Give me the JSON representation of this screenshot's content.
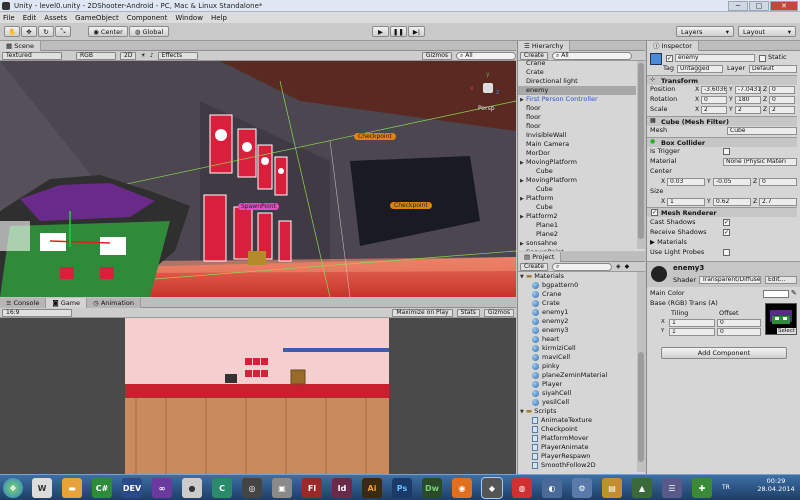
{
  "window": {
    "title": "Unity - level0.unity - 2DShooter-Android - PC, Mac & Linux Standalone*",
    "controls": [
      "─",
      "□",
      "✕"
    ]
  },
  "menu": [
    "File",
    "Edit",
    "Assets",
    "GameObject",
    "Component",
    "Window",
    "Help"
  ],
  "toolbar": {
    "center": "Center",
    "global": "Global",
    "layers": "Layers",
    "layout": "Layout"
  },
  "scene": {
    "tab": "Scene",
    "render_mode": "Textured",
    "color_mode": "RGB",
    "mode_2d": "2D",
    "effects": "Effects",
    "gizmos": "Gizmos",
    "search": "All",
    "labels": [
      "Checkpoint",
      "SpawnPoint",
      "Checkpoint"
    ],
    "persp": "Persp",
    "gizmo_axes": [
      "y",
      "x",
      "z"
    ]
  },
  "bottom_tabs": [
    "Console",
    "Game",
    "Animation"
  ],
  "game": {
    "aspect": "16:9",
    "maximize": "Maximize on Play",
    "stats": "Stats",
    "gizmos": "Gizmos"
  },
  "hierarchy": {
    "tab": "Hierarchy",
    "create": "Create",
    "search": "All",
    "items": [
      {
        "label": "Crane",
        "indent": 0,
        "arrow": false,
        "selected": false,
        "blue": false
      },
      {
        "label": "Crate",
        "indent": 0,
        "arrow": false,
        "selected": false,
        "blue": false
      },
      {
        "label": "Directional light",
        "indent": 0,
        "arrow": false,
        "selected": false,
        "blue": false
      },
      {
        "label": "enemy",
        "indent": 0,
        "arrow": false,
        "selected": true,
        "blue": false
      },
      {
        "label": "First Person Controller",
        "indent": 0,
        "arrow": true,
        "selected": false,
        "blue": true
      },
      {
        "label": "floor",
        "indent": 0,
        "arrow": false,
        "selected": false,
        "blue": false
      },
      {
        "label": "floor",
        "indent": 0,
        "arrow": false,
        "selected": false,
        "blue": false
      },
      {
        "label": "floor",
        "indent": 0,
        "arrow": false,
        "selected": false,
        "blue": false
      },
      {
        "label": "InvisibleWall",
        "indent": 0,
        "arrow": false,
        "selected": false,
        "blue": false
      },
      {
        "label": "Main Camera",
        "indent": 0,
        "arrow": false,
        "selected": false,
        "blue": false
      },
      {
        "label": "MorDor",
        "indent": 0,
        "arrow": false,
        "selected": false,
        "blue": false
      },
      {
        "label": "MovingPlatform",
        "indent": 0,
        "arrow": true,
        "selected": false,
        "blue": false
      },
      {
        "label": "Cube",
        "indent": 1,
        "arrow": false,
        "selected": false,
        "blue": false
      },
      {
        "label": "MovingPlatform",
        "indent": 0,
        "arrow": true,
        "selected": false,
        "blue": false
      },
      {
        "label": "Cube",
        "indent": 1,
        "arrow": false,
        "selected": false,
        "blue": false
      },
      {
        "label": "Platform",
        "indent": 0,
        "arrow": true,
        "selected": false,
        "blue": false
      },
      {
        "label": "Cube",
        "indent": 1,
        "arrow": false,
        "selected": false,
        "blue": false
      },
      {
        "label": "Platform2",
        "indent": 0,
        "arrow": true,
        "selected": false,
        "blue": false
      },
      {
        "label": "Plane1",
        "indent": 1,
        "arrow": false,
        "selected": false,
        "blue": false
      },
      {
        "label": "Plane2",
        "indent": 1,
        "arrow": false,
        "selected": false,
        "blue": false
      },
      {
        "label": "sonsahne",
        "indent": 0,
        "arrow": true,
        "selected": false,
        "blue": false
      },
      {
        "label": "SpawnPoint",
        "indent": 0,
        "arrow": false,
        "selected": false,
        "blue": false
      }
    ]
  },
  "project": {
    "tab": "Project",
    "create": "Create",
    "materials_folder": "Materials",
    "materials": [
      "bgpattern0",
      "Crane",
      "Crate",
      "enemy1",
      "enemy2",
      "enemy3",
      "heart",
      "kirmiziCell",
      "maviCell",
      "pinky",
      "planeZeminMaterial",
      "Player",
      "siyahCell",
      "yesilCell"
    ],
    "scripts_folder": "Scripts",
    "scripts": [
      "AnimateTexture",
      "Checkpoint",
      "PlatformMover",
      "PlayerAnimate",
      "PlayerRespawn",
      "SmoothFollow2D"
    ]
  },
  "inspector": {
    "tab": "Inspector",
    "object_name": "enemy",
    "static": "Static",
    "tag_label": "Tag",
    "tag": "Untagged",
    "layer_label": "Layer",
    "layer": "Default",
    "transform": {
      "title": "Transform",
      "position_label": "Position",
      "position": [
        "-3.6036",
        "-7.0431",
        "0"
      ],
      "rotation_label": "Rotation",
      "rotation": [
        "0",
        "180",
        "0"
      ],
      "scale_label": "Scale",
      "scale": [
        "2",
        "2",
        "2"
      ]
    },
    "mesh_filter": {
      "title": "Cube (Mesh Filter)",
      "mesh_label": "Mesh",
      "mesh": "Cube"
    },
    "box_collider": {
      "title": "Box Collider",
      "is_trigger": "Is Trigger",
      "material_label": "Material",
      "material": "None (Physic Materi",
      "center_label": "Center",
      "center": [
        "0.03",
        "-0.05",
        "0"
      ],
      "size_label": "Size",
      "size": [
        "1",
        "0.62",
        "2.7"
      ]
    },
    "mesh_renderer": {
      "title": "Mesh Renderer",
      "cast_shadows": "Cast Shadows",
      "receive_shadows": "Receive Shadows",
      "materials": "Materials",
      "use_light_probes": "Use Light Probes"
    },
    "material": {
      "name": "enemy3",
      "shader_label": "Shader",
      "shader": "Transparent/Diffuse",
      "edit": "Edit...",
      "main_color": "Main Color",
      "base_label": "Base (RGB) Trans (A)",
      "tiling": "Tiling",
      "offset": "Offset",
      "tile_x": "1",
      "tile_y": "1",
      "off_x": "0",
      "off_y": "0",
      "select": "Select"
    },
    "add_component": "Add Component"
  },
  "axis_letters": [
    "X",
    "Y",
    "Z"
  ],
  "taskbar": {
    "lang": "TR",
    "time": "00:29",
    "date": "28.04.2014"
  },
  "colors": {
    "selection": "#a8a8a8",
    "hierarchy_blue": "#2a55c7",
    "checkpoint_label": "#e0830e",
    "spawn_label": "#e04fc2"
  }
}
